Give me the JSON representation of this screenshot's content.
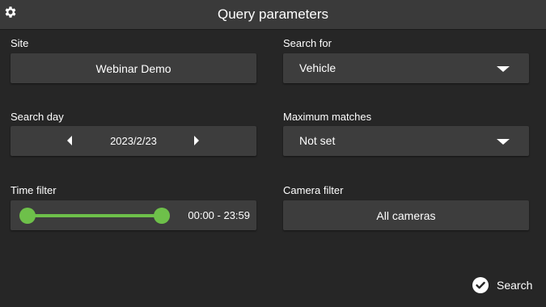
{
  "header": {
    "title": "Query parameters",
    "settings_icon": "gear-icon"
  },
  "site": {
    "label": "Site",
    "value": "Webinar Demo"
  },
  "search_for": {
    "label": "Search for",
    "value": "Vehicle"
  },
  "search_day": {
    "label": "Search day",
    "value": "2023/2/23"
  },
  "max_matches": {
    "label": "Maximum matches",
    "value": "Not set"
  },
  "time_filter": {
    "label": "Time filter",
    "value": "00:00 - 23:59",
    "range_start": "00:00",
    "range_end": "23:59",
    "slider_color": "#6ec04a"
  },
  "camera_filter": {
    "label": "Camera filter",
    "value": "All cameras"
  },
  "actions": {
    "search_label": "Search"
  }
}
